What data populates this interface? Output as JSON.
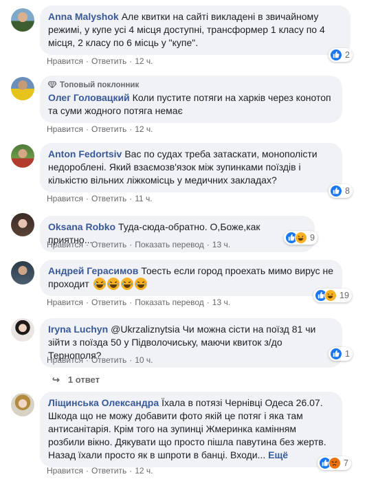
{
  "actions": {
    "like": "Нравится",
    "reply": "Ответить",
    "translate": "Показать перевод",
    "sep": "·"
  },
  "comments": [
    {
      "author": "Anna Malyshok",
      "text": "Але квитки на сайті викладені в звичайному режимі, у купе усі 4 місця доступні, трансформер 1 класу по 4 місця, 2 класу по 6 місць у \"купе\".",
      "time": "12 ч.",
      "reactions": {
        "count": "2",
        "icons": [
          "like"
        ]
      }
    },
    {
      "badge": "Топовый поклонник",
      "author": "Олег Головацкий",
      "text": "Коли пустите потяги на харків через конотоп та суми жодного потяга немає",
      "time": "12 ч."
    },
    {
      "author": "Anton Fedortsiv",
      "text": "Вас по судах треба затаскати, монополісти недороблені. Який взаємозв'язок між зупинками поїздів і кількістю вільних ліжкомісць у медичних закладах?",
      "time": "11 ч.",
      "reactions": {
        "count": "8",
        "icons": [
          "like"
        ]
      }
    },
    {
      "author": "Oksana Robko",
      "text": "Туда-сюда-обратно. О,Боже,как приятно...",
      "time": "13 ч.",
      "translate": true,
      "reactions": {
        "count": "9",
        "icons": [
          "like",
          "haha"
        ]
      }
    },
    {
      "author": "Андрей Герасимов",
      "text": "Тоесть если город проехать мимо вирус не проходит",
      "emoji": [
        "haha",
        "haha",
        "haha",
        "haha"
      ],
      "time": "13 ч.",
      "translate": true,
      "reactions": {
        "count": "19",
        "icons": [
          "like",
          "haha"
        ]
      }
    },
    {
      "author": "Iryna Luchyn",
      "text": "@Ukrzaliznytsia Чи можна сісти на поїзд 81 чи зійти з поїзда 50 у Підволочиську, маючи квиток з/до Тернополя?",
      "time": "10 ч.",
      "reactions": {
        "count": "1",
        "icons": [
          "like"
        ]
      }
    },
    {
      "author": "Ліщинська Олександра",
      "text": "Їхала в потязі Чернівці Одеса 26.07. Шкода що не можу добавити фото якій це потяг і яка там антисанітарія. Крім того на зупинці Жмеринка камінням розбили вікно. Дякувати що просто пішла павутина без жертв. Назад їхали просто як в шпроти в банці. Входи...",
      "more": "Ещё",
      "time": "12 ч.",
      "reactions": {
        "count": "7",
        "icons": [
          "like",
          "angry"
        ]
      }
    }
  ],
  "replies": {
    "arrow": "↪",
    "label": "1 ответ"
  },
  "colors": {
    "author": "#385898",
    "bubble": "#f0f2f5",
    "meta": "#65676b",
    "like": "#1877f2",
    "haha": "#f7b125",
    "angry": "#e9710f"
  }
}
